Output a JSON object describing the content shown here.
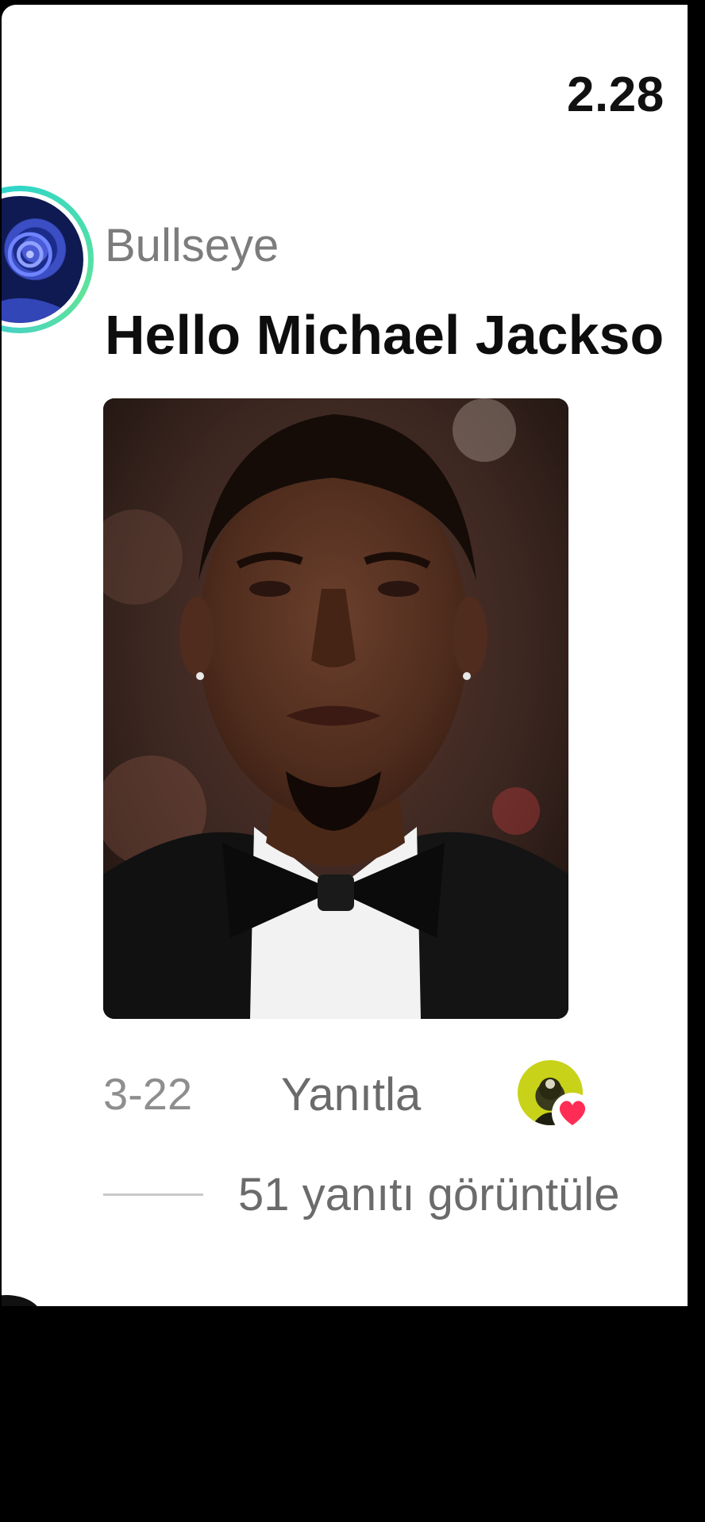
{
  "header": {
    "count": "2.28"
  },
  "comment": {
    "author": "Bullseye",
    "text": "Hello Michael Jackso",
    "date": "3-22",
    "reply_label": "Yanıtla",
    "view_replies_label": "51 yanıtı görüntüle",
    "icons": {
      "avatar": "author-avatar",
      "liked_by": "creator-liked-avatar",
      "heart": "heart-icon"
    }
  },
  "colors": {
    "ring_accent": "#32d6c6",
    "heart": "#ff2d55",
    "text_primary": "#0d0d0d",
    "text_secondary": "#7c7c7c"
  }
}
